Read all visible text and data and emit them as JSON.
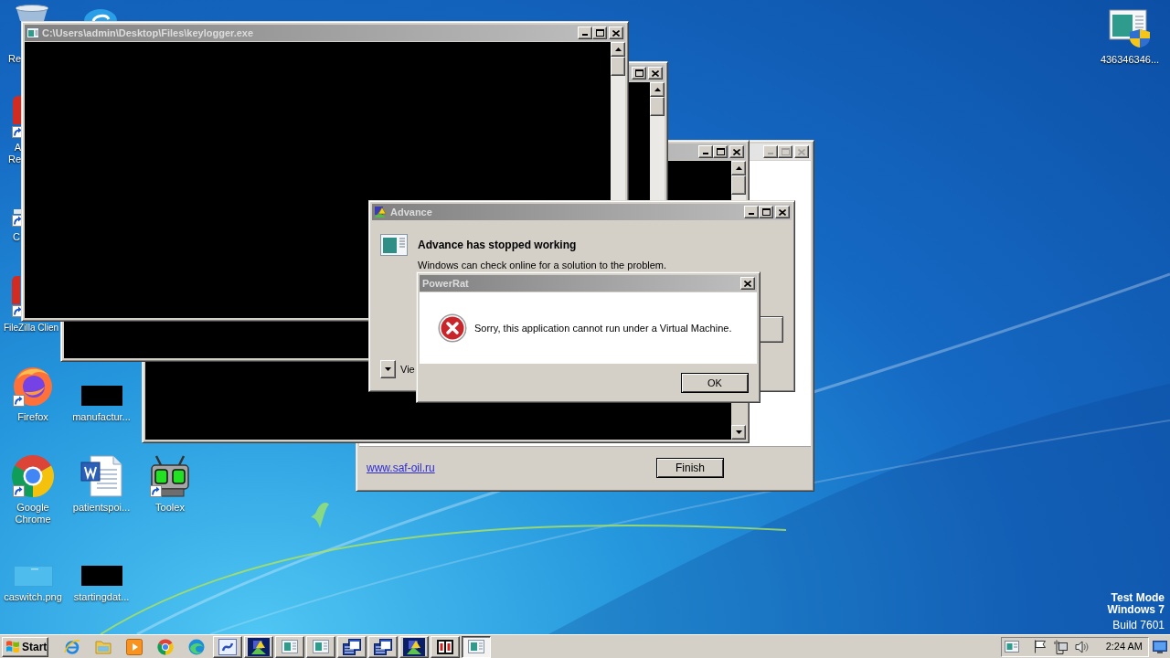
{
  "desktop": {
    "icons": [
      {
        "kind": "recycle-bin",
        "label": "Re"
      },
      {
        "kind": "round-app"
      },
      {
        "kind": "red-app",
        "shortcut": true,
        "label": "A Re"
      },
      {
        "kind": "shortcut-app",
        "shortcut": true,
        "label": "C"
      },
      {
        "kind": "red-app",
        "shortcut": true,
        "label": "FileZilla Clien"
      },
      {
        "kind": "fox-browser",
        "shortcut": true,
        "label": "Firefox"
      },
      {
        "kind": "dark-image",
        "shortcut": false,
        "label": "manufactur..."
      },
      {
        "kind": "chrome-browser",
        "shortcut": true,
        "label": "Google Chrome"
      },
      {
        "kind": "document",
        "shortcut": false,
        "label": "patientspoi..."
      },
      {
        "kind": "robot",
        "shortcut": true,
        "label": "Toolex"
      },
      {
        "kind": "light-image",
        "shortcut": false,
        "label": "caswitch.png"
      },
      {
        "kind": "dark-image",
        "shortcut": false,
        "label": "startingdat..."
      },
      {
        "kind": "shield-app",
        "shortcut": false,
        "label": "436346346..."
      }
    ]
  },
  "windows": [
    {
      "kind": "installer",
      "link": "www.saf-oil.ru",
      "button": "Finish"
    },
    {
      "kind": "console"
    },
    {
      "kind": "console"
    },
    {
      "kind": "console",
      "title": "C:\\Users\\admin\\Desktop\\Files\\keylogger.exe"
    },
    {
      "kind": "error-report",
      "title": "Advance",
      "heading": "Advance has stopped working",
      "text": "Windows can check online for a solution to the problem.",
      "details": "Vie"
    },
    {
      "kind": "message-box",
      "title": "PowerRat",
      "message": "Sorry, this application cannot run under a Virtual Machine.",
      "button": "OK"
    }
  ],
  "system_text": [
    "Test Mode",
    "Windows 7",
    "Build 7601"
  ],
  "taskbar": {
    "start": "Start",
    "quick_launch": [
      {
        "kind": "ie"
      },
      {
        "kind": "folder"
      },
      {
        "kind": "player"
      },
      {
        "kind": "chrome"
      },
      {
        "kind": "edge"
      }
    ],
    "tasks": [
      {
        "kind": "globe",
        "selected": false
      },
      {
        "kind": "advance",
        "selected": false
      },
      {
        "kind": "window",
        "selected": false
      },
      {
        "kind": "window",
        "selected": false
      },
      {
        "kind": "console",
        "selected": false
      },
      {
        "kind": "console",
        "selected": false
      },
      {
        "kind": "advance",
        "selected": false
      },
      {
        "kind": "dialog",
        "selected": false
      },
      {
        "kind": "window",
        "selected": true
      }
    ],
    "tray": {
      "icons": [
        {
          "kind": "window"
        },
        {
          "kind": "flag"
        },
        {
          "kind": "network"
        },
        {
          "kind": "speaker"
        }
      ],
      "clock": "2:24 AM"
    }
  }
}
